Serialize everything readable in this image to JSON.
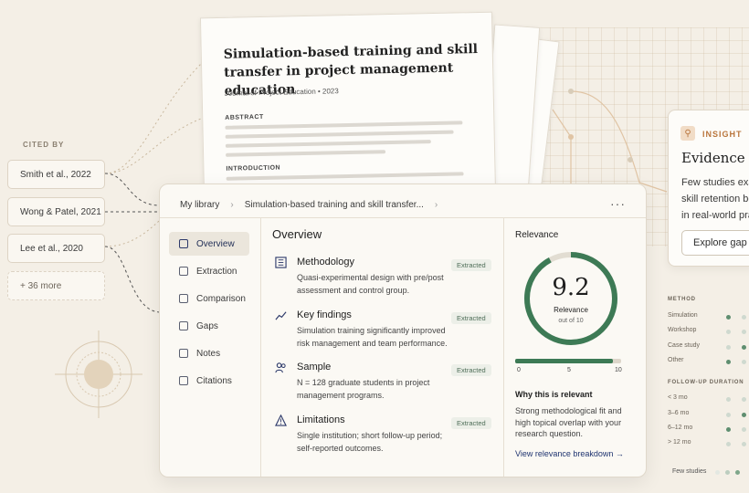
{
  "cited_by": {
    "label": "CITED BY",
    "items": [
      "Smith et al., 2022",
      "Wong & Patel, 2021",
      "Lee et al., 2020"
    ],
    "more": "+ 36 more"
  },
  "paper": {
    "title": "Simulation-based training and skill transfer in project management education",
    "journal": "Journal of Project Education • 2023",
    "abstract_label": "ABSTRACT",
    "introduction_label": "INTRODUCTION"
  },
  "insight": {
    "tag": "INSIGHT",
    "title": "Evidence gap",
    "body_lines": [
      "Few studies examine",
      "skill retention beyond",
      "in real-world practice."
    ],
    "button": "Explore gap",
    "accent": "#b9753c"
  },
  "evidence_table": {
    "method_header": "METHOD",
    "methods": [
      "Simulation",
      "Workshop",
      "Case study",
      "Other"
    ],
    "duration_header": "FOLLOW-UP DURATION",
    "durations": [
      "< 3 mo",
      "3–6 mo",
      "6–12 mo",
      "> 12 mo"
    ],
    "legend": "Few studies"
  },
  "card": {
    "breadcrumb": [
      "My library",
      "Simulation-based training and skill transfer..."
    ],
    "nav": [
      {
        "label": "Overview",
        "icon": "home-icon",
        "active": true
      },
      {
        "label": "Extraction",
        "icon": "extract-icon",
        "active": false
      },
      {
        "label": "Comparison",
        "icon": "compare-icon",
        "active": false
      },
      {
        "label": "Gaps",
        "icon": "gap-icon",
        "active": false
      },
      {
        "label": "Notes",
        "icon": "notes-icon",
        "active": false
      },
      {
        "label": "Citations",
        "icon": "book-icon",
        "active": false
      }
    ],
    "overview": {
      "title": "Overview",
      "items": [
        {
          "title": "Methodology",
          "desc": "Quasi-experimental design with pre/post assessment and control group.",
          "badge": "Extracted",
          "icon": "table-icon"
        },
        {
          "title": "Key findings",
          "desc": "Simulation training significantly improved risk management and team performance.",
          "badge": "Extracted",
          "icon": "trend-icon"
        },
        {
          "title": "Sample",
          "desc": "N = 128 graduate students in project management programs.",
          "badge": "Extracted",
          "icon": "users-icon"
        },
        {
          "title": "Limitations",
          "desc": "Single institution; short follow-up period; self-reported outcomes.",
          "badge": "Extracted",
          "icon": "warning-icon"
        }
      ]
    },
    "relevance": {
      "title": "Relevance",
      "score": "9.2",
      "score_value": 9.2,
      "label": "Relevance",
      "out_of": "out of 10",
      "scale_ticks": [
        "0",
        "5",
        "10"
      ],
      "why_title": "Why this is relevant",
      "why_body": "Strong methodological fit and high topical overlap with your research question.",
      "link": "View relevance breakdown →",
      "accent": "#3d7a55"
    }
  }
}
